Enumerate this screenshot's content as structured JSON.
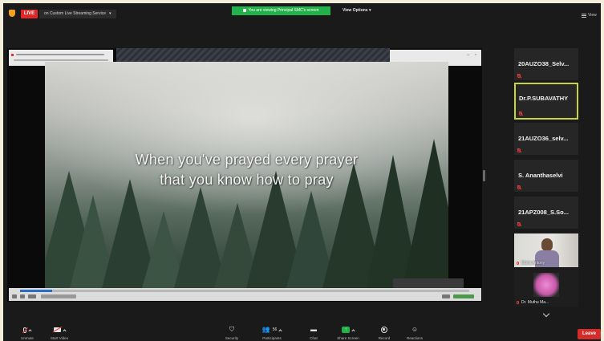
{
  "topbar": {
    "live_label": "LIVE",
    "stream_label": "on Custom Live Streaming Service",
    "viewing_banner": "You are viewing Principal SMC's screen",
    "view_options_label": "View Options",
    "view_label": "View"
  },
  "shared_screen": {
    "lyric_line_1": "When you've prayed every prayer",
    "lyric_line_2": "that you know how to pray"
  },
  "participants": [
    {
      "name": "20AUZO38_Selv..."
    },
    {
      "name": "Dr.P.SUBAVATHY",
      "active": true
    },
    {
      "name": "21AUZO36_selv..."
    },
    {
      "name": "S. Ananthaselvi"
    },
    {
      "name": "21APZ008_S.So..."
    },
    {
      "name": "Maria Antony"
    },
    {
      "name": "Dr. Muthu Ma..."
    }
  ],
  "toolbar": {
    "unmute": "Unmute",
    "start_video": "Start Video",
    "security": "Security",
    "participants": "Participants",
    "participant_count": "56",
    "chat": "Chat",
    "share_screen": "Share Screen",
    "record": "Record",
    "reactions": "Reactions",
    "leave": "Leave"
  },
  "colors": {
    "live_red": "#e02828",
    "banner_green": "#23b14a",
    "active_speaker": "#c9d33a",
    "leave_red": "#d42b2b"
  }
}
